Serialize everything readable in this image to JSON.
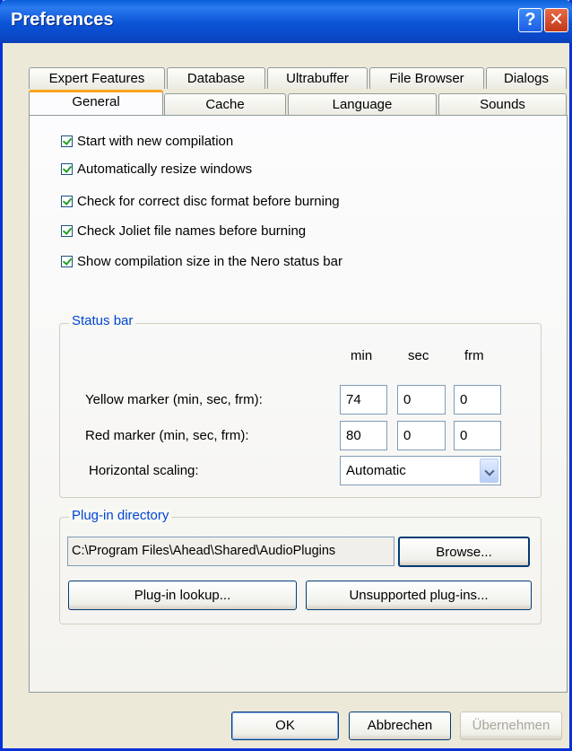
{
  "window": {
    "title": "Preferences"
  },
  "titlebar": {
    "help_glyph": "?",
    "close_glyph": "✕"
  },
  "tabs": {
    "row1": [
      "Expert Features",
      "Database",
      "Ultrabuffer",
      "File Browser",
      "Dialogs"
    ],
    "row2": [
      "General",
      "Cache",
      "Language",
      "Sounds"
    ],
    "active": "General"
  },
  "general": {
    "checkboxes": [
      {
        "label": "Start with new compilation",
        "checked": true
      },
      {
        "label": "Automatically resize windows",
        "checked": true
      },
      {
        "label": "Check for correct disc format before burning",
        "checked": true
      },
      {
        "label": "Check Joliet file names before burning",
        "checked": true
      },
      {
        "label": "Show compilation size in the Nero status bar",
        "checked": true
      }
    ]
  },
  "status_bar": {
    "title": "Status bar",
    "col_min": "min",
    "col_sec": "sec",
    "col_frm": "frm",
    "yellow_label": "Yellow marker (min, sec, frm):",
    "yellow_min": "74",
    "yellow_sec": "0",
    "yellow_frm": "0",
    "red_label": "Red marker (min, sec, frm):",
    "red_min": "80",
    "red_sec": "0",
    "red_frm": "0",
    "scaling_label": "Horizontal scaling:",
    "scaling_value": "Automatic"
  },
  "plugin": {
    "title": "Plug-in directory",
    "path": "C:\\Program Files\\Ahead\\Shared\\AudioPlugins",
    "browse": "Browse...",
    "lookup": "Plug-in lookup...",
    "unsupported": "Unsupported plug-ins..."
  },
  "footer": {
    "ok": "OK",
    "cancel": "Abbrechen",
    "apply": "Übernehmen"
  },
  "colors": {
    "accent": "#0046d5",
    "titlebar": "#0b53d6",
    "tab_highlight": "#f7a51c",
    "check": "#21a121"
  }
}
